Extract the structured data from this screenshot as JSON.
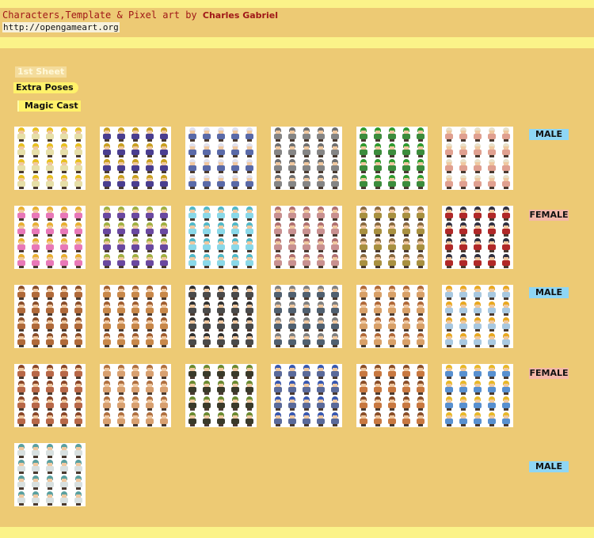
{
  "header": {
    "title_prefix": "Characters,Template & Pixel art by",
    "author": "Charles Gabriel",
    "url": "http://opengameart.org"
  },
  "nav": [
    {
      "label": "1st Sheet"
    },
    {
      "label": "Extra Poses"
    },
    {
      "label": "Magic Cast"
    }
  ],
  "rows": [
    {
      "label": "MALE",
      "label_color": "#8fd6f4",
      "sheets": [
        {
          "hair": "#e8c020",
          "body": "#e6dfa8"
        },
        {
          "hair": "#c9a020",
          "body": "#4a3e90"
        },
        {
          "hair": "#e0e0ec",
          "body": "#5a6aa8"
        },
        {
          "hair": "#707070",
          "body": "#858585"
        },
        {
          "hair": "#2f9a2f",
          "body": "#3c8c3c"
        },
        {
          "hair": "#e8e0c8",
          "body": "#e0a090"
        }
      ]
    },
    {
      "label": "FEMALE",
      "label_color": "#f4b8a8",
      "sheets": [
        {
          "hair": "#e8b030",
          "body": "#e878b8"
        },
        {
          "hair": "#a0b040",
          "body": "#6a48a0"
        },
        {
          "hair": "#50b8c8",
          "body": "#8ad8e8"
        },
        {
          "hair": "#b07070",
          "body": "#c89090"
        },
        {
          "hair": "#8a6a40",
          "body": "#a89040"
        },
        {
          "hair": "#303040",
          "body": "#b02828"
        }
      ]
    },
    {
      "label": "MALE",
      "label_color": "#8fd6f4",
      "sheets": [
        {
          "hair": "#8a4e2a",
          "body": "#b06a3a"
        },
        {
          "hair": "#a05e30",
          "body": "#c8884a"
        },
        {
          "hair": "#303030",
          "body": "#4a4a4a"
        },
        {
          "hair": "#808080",
          "body": "#506070"
        },
        {
          "hair": "#b06838",
          "body": "#d8a068"
        },
        {
          "hair": "#e8a820",
          "body": "#a8c8e0"
        }
      ]
    },
    {
      "label": "FEMALE",
      "label_color": "#f4b8a8",
      "sheets": [
        {
          "hair": "#8a4628",
          "body": "#b86848"
        },
        {
          "hair": "#b07040",
          "body": "#d8a070"
        },
        {
          "hair": "#6a8a30",
          "body": "#3a3a2a"
        },
        {
          "hair": "#3858b0",
          "body": "#5a6a9a"
        },
        {
          "hair": "#8a4e28",
          "body": "#c87840"
        },
        {
          "hair": "#e8b828",
          "body": "#5890d0"
        }
      ]
    },
    {
      "label": "MALE",
      "label_color": "#8fd6f4",
      "sheets": [
        {
          "hair": "#5aa0a0",
          "body": "#d8e0e0"
        }
      ]
    }
  ]
}
